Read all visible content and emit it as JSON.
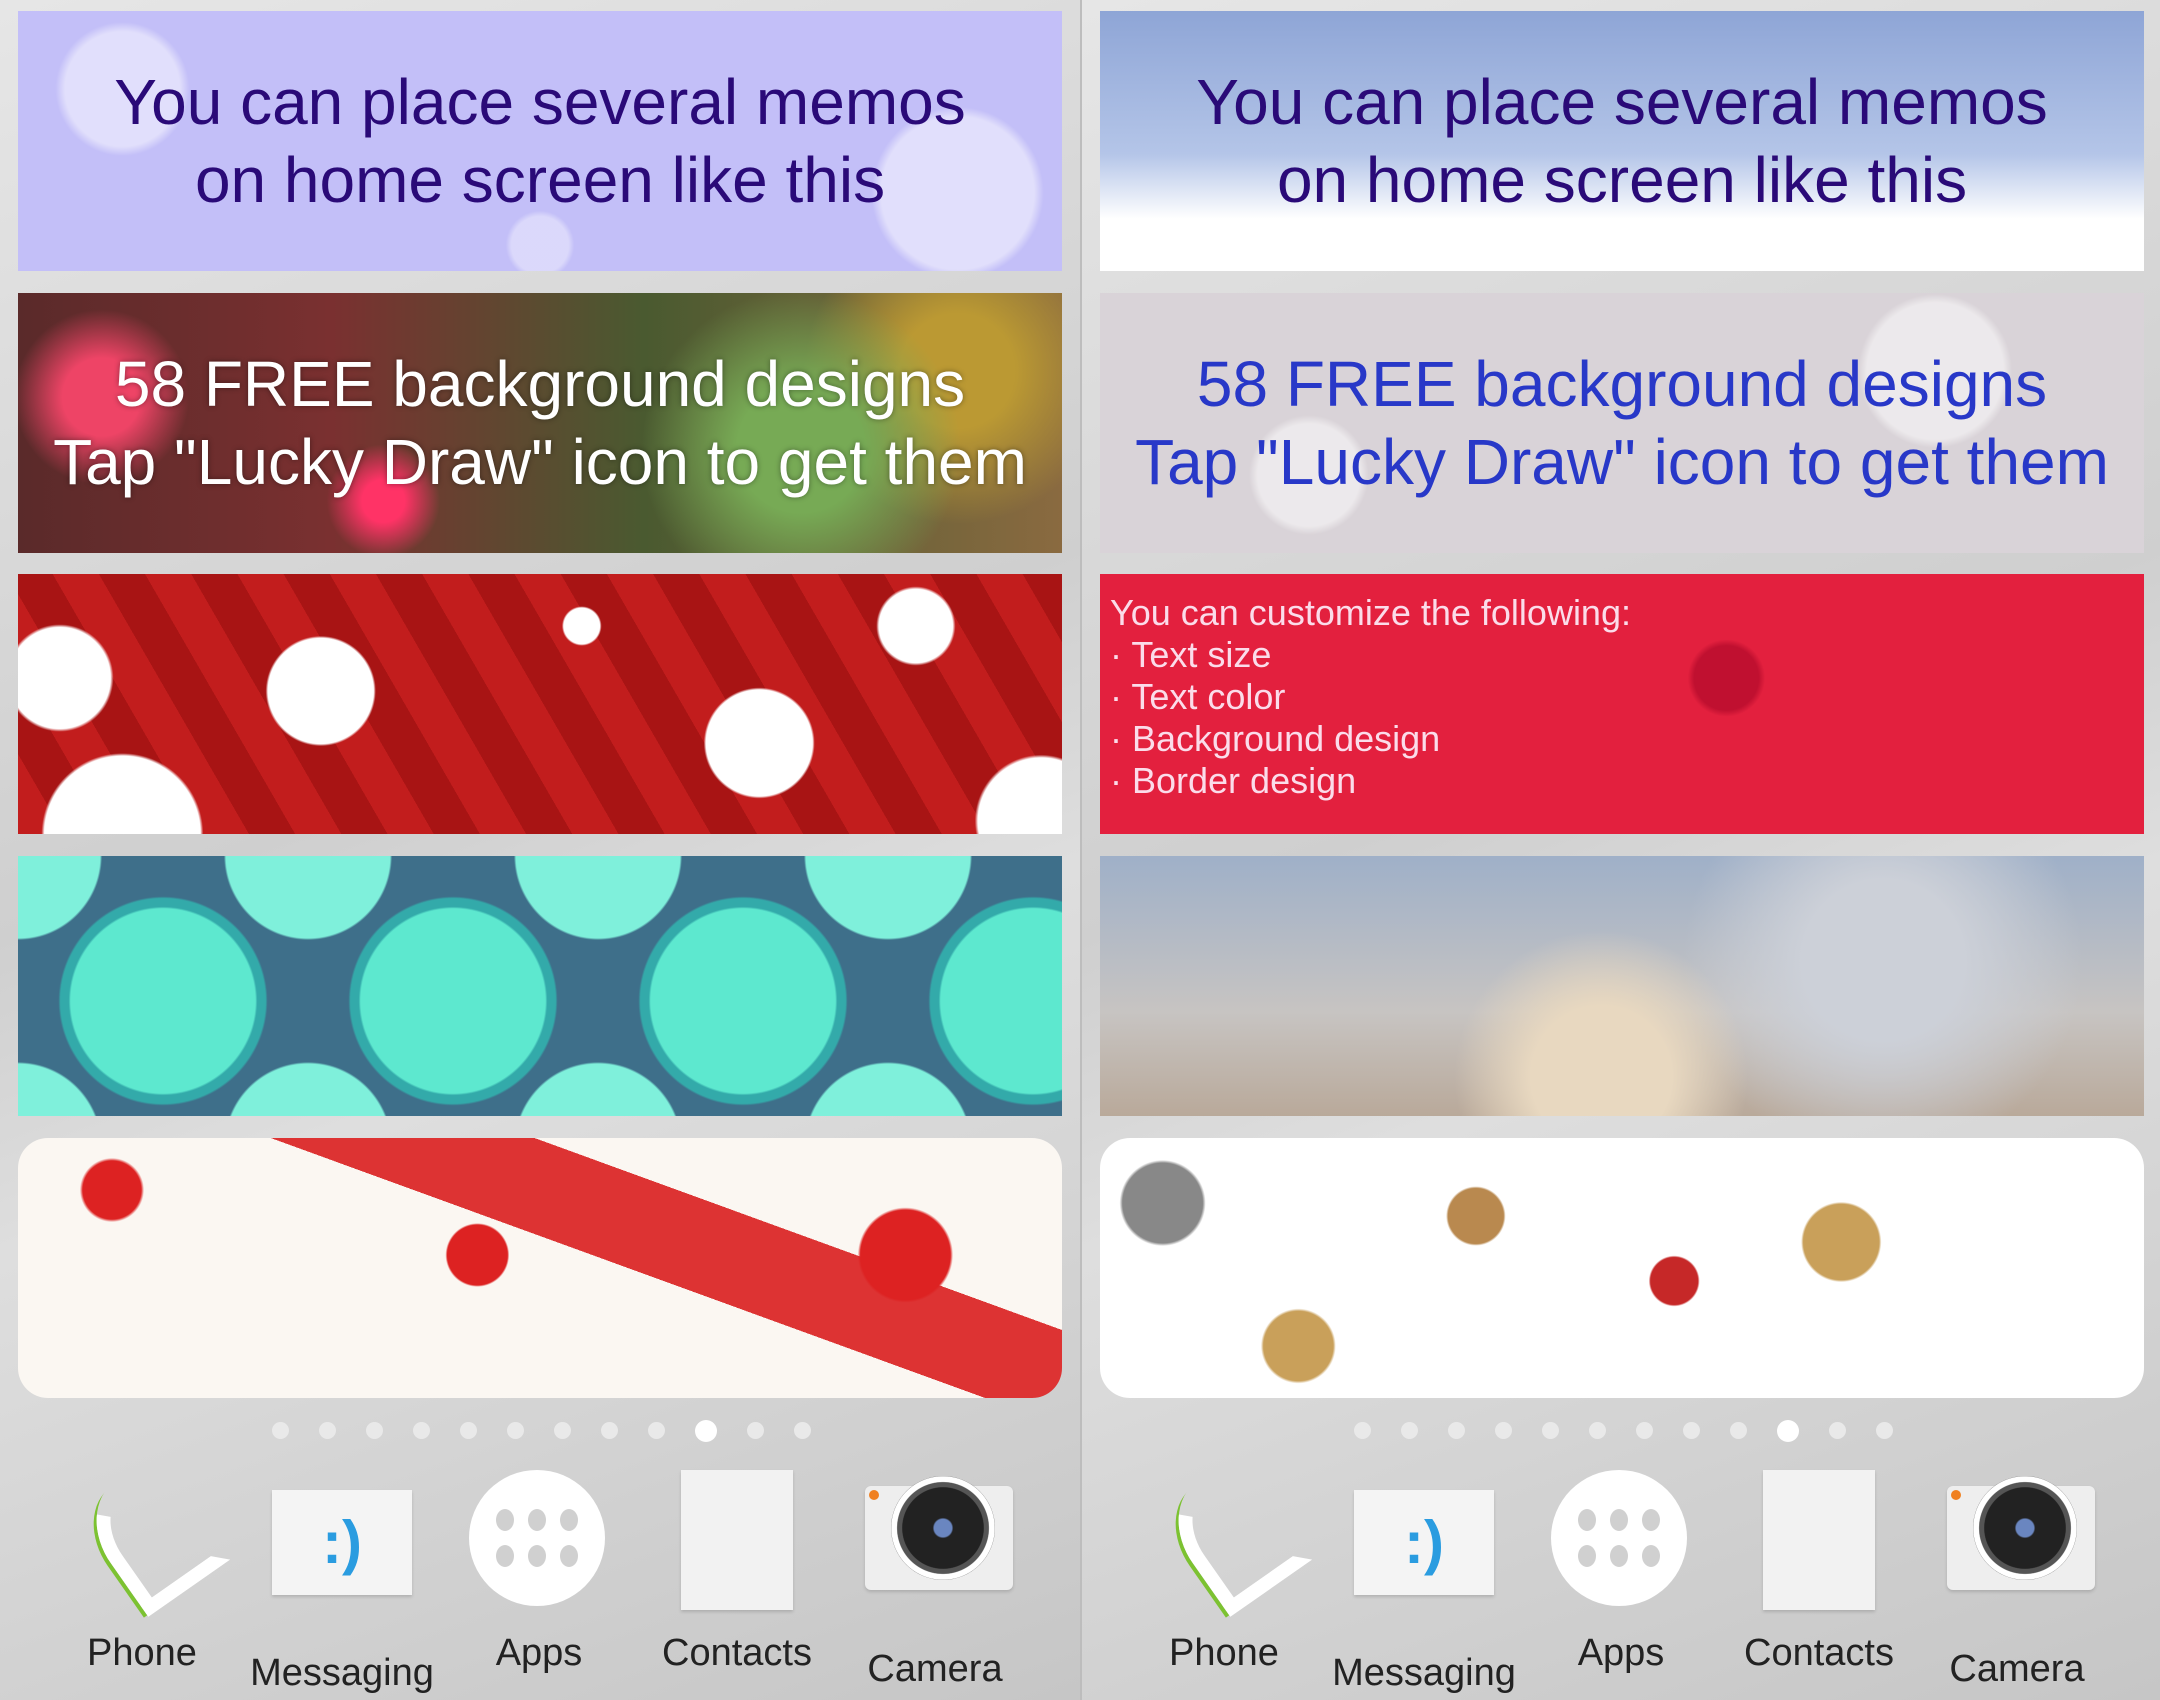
{
  "left": {
    "memos": [
      {
        "lines": [
          "You can place several memos",
          "on home screen like this"
        ],
        "design": "lavender snowflakes"
      },
      {
        "lines": [
          "58 FREE background designs",
          "Tap \"Lucky Draw\" icon to get them"
        ],
        "design": "bokeh"
      },
      {
        "lines": [],
        "design": "red ornaments"
      },
      {
        "lines": [],
        "design": "teal snowflake circles"
      },
      {
        "lines": [],
        "design": "gifts and stars"
      }
    ],
    "page_indicator": {
      "total": 12,
      "active": 10
    }
  },
  "right": {
    "memos": [
      {
        "lines": [
          "You can place several memos",
          "on home screen like this"
        ],
        "design": "blue frost"
      },
      {
        "lines": [
          "58 FREE background designs",
          "Tap \"Lucky Draw\" icon to get them"
        ],
        "design": "grey snowflakes"
      },
      {
        "lines": [
          "You can customize the following:",
          "· Text size",
          "· Text color",
          "· Background design",
          "· Border design"
        ],
        "design": "red pine"
      },
      {
        "lines": [],
        "design": "blurred winter bokeh"
      },
      {
        "lines": [],
        "design": "gingerbread and snowflakes"
      }
    ],
    "page_indicator": {
      "total": 12,
      "active": 10
    }
  },
  "dock": [
    {
      "label": "Phone",
      "icon": "phone-icon"
    },
    {
      "label": "Messaging",
      "icon": "messaging-icon"
    },
    {
      "label": "Apps",
      "icon": "apps-grid-icon"
    },
    {
      "label": "Contacts",
      "icon": "contacts-icon"
    },
    {
      "label": "Camera",
      "icon": "camera-icon"
    }
  ],
  "colors": {
    "memo_text_purple": "#2a0a78",
    "memo_text_blue": "#2838c8",
    "phone_green": "#7cc231",
    "messaging_blue": "#2a9ce0",
    "contacts_red": "#e03020"
  }
}
